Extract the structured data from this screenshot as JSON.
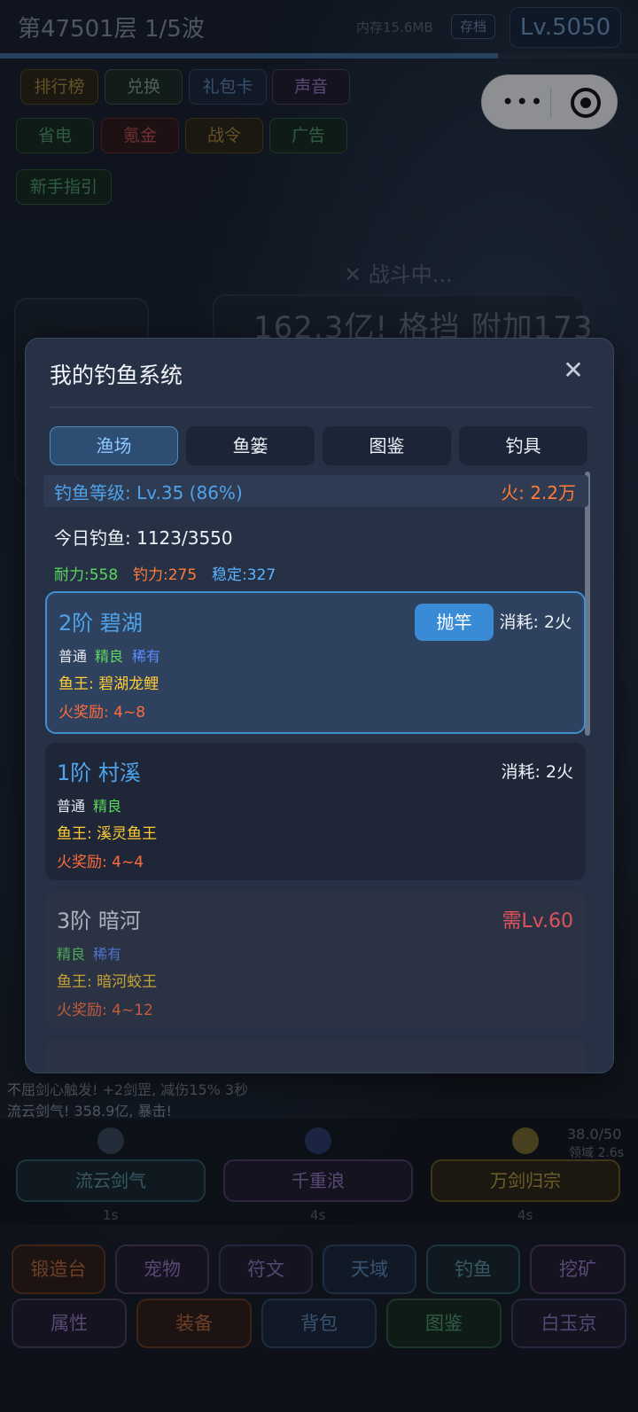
{
  "game": {
    "wave_title": "第47501层  1/5波",
    "memory": "内存15.6MB",
    "save_label": "存档",
    "level_badge": "Lv.5050",
    "wave_progress": 0.78,
    "menu_row1": [
      "排行榜",
      "兑换",
      "礼包卡",
      "声音"
    ],
    "menu_row2": [
      "省电",
      "氪金",
      "战令",
      "广告"
    ],
    "guide_label": "新手指引",
    "combat_status": "✕ 战斗中...",
    "floating_damage": "162.3亿! 格挡 附加173",
    "log_lines": [
      "不屈剑心触发! +2剑罡, 减伤15% 3秒",
      "流云剑气! 358.9亿, 暴击!"
    ],
    "energy": "38.0/50",
    "domain_cd": "领域 2.6s",
    "skills": [
      {
        "name": "流云剑气",
        "cd": "1s"
      },
      {
        "name": "千重浪",
        "cd": "4s"
      },
      {
        "name": "万剑归宗",
        "cd": "4s"
      }
    ],
    "nav_row1": [
      "锻造台",
      "宠物",
      "符文",
      "天域",
      "钓鱼",
      "挖矿"
    ],
    "nav_row2": [
      "属性",
      "装备",
      "背包",
      "图鉴",
      "白玉京"
    ]
  },
  "modal": {
    "title": "我的钓鱼系统",
    "close_glyph": "✕",
    "tabs": [
      "渔场",
      "鱼篓",
      "图鉴",
      "钓具"
    ],
    "active_tab": "渔场",
    "fishing_level": "钓鱼等级: Lv.35 (86%)",
    "fire": "火: 2.2万",
    "today_catch": "今日钓鱼: 1123/3550",
    "stats": {
      "stamina": "耐力:558",
      "power": "钓力:275",
      "stability": "稳定:327"
    },
    "spots": [
      {
        "name": "2阶 碧湖",
        "cast_label": "抛竿",
        "cost": "消耗: 2火",
        "rarities": [
          "普通",
          "精良",
          "稀有"
        ],
        "king": "鱼王: 碧湖龙鲤",
        "reward": "火奖励: 4~8",
        "state": "selected"
      },
      {
        "name": "1阶 村溪",
        "cost": "消耗: 2火",
        "rarities": [
          "普通",
          "精良"
        ],
        "king": "鱼王: 溪灵鱼王",
        "reward": "火奖励: 4~4",
        "state": "unlocked"
      },
      {
        "name": "3阶 暗河",
        "requirement": "需Lv.60",
        "rarities": [
          "精良",
          "稀有"
        ],
        "king": "鱼王: 暗河蛟王",
        "reward": "火奖励: 4~12",
        "state": "locked"
      }
    ]
  },
  "colors": {
    "accent": "#4fa3ea",
    "fire": "#ff7b3a",
    "common": "#e6e9ef",
    "fine": "#5cd65c",
    "rare": "#5b8cff",
    "king": "#ffcc33",
    "locked": "#e0525c"
  },
  "icons": [
    "close-icon",
    "more-dots-icon",
    "record-icon"
  ]
}
